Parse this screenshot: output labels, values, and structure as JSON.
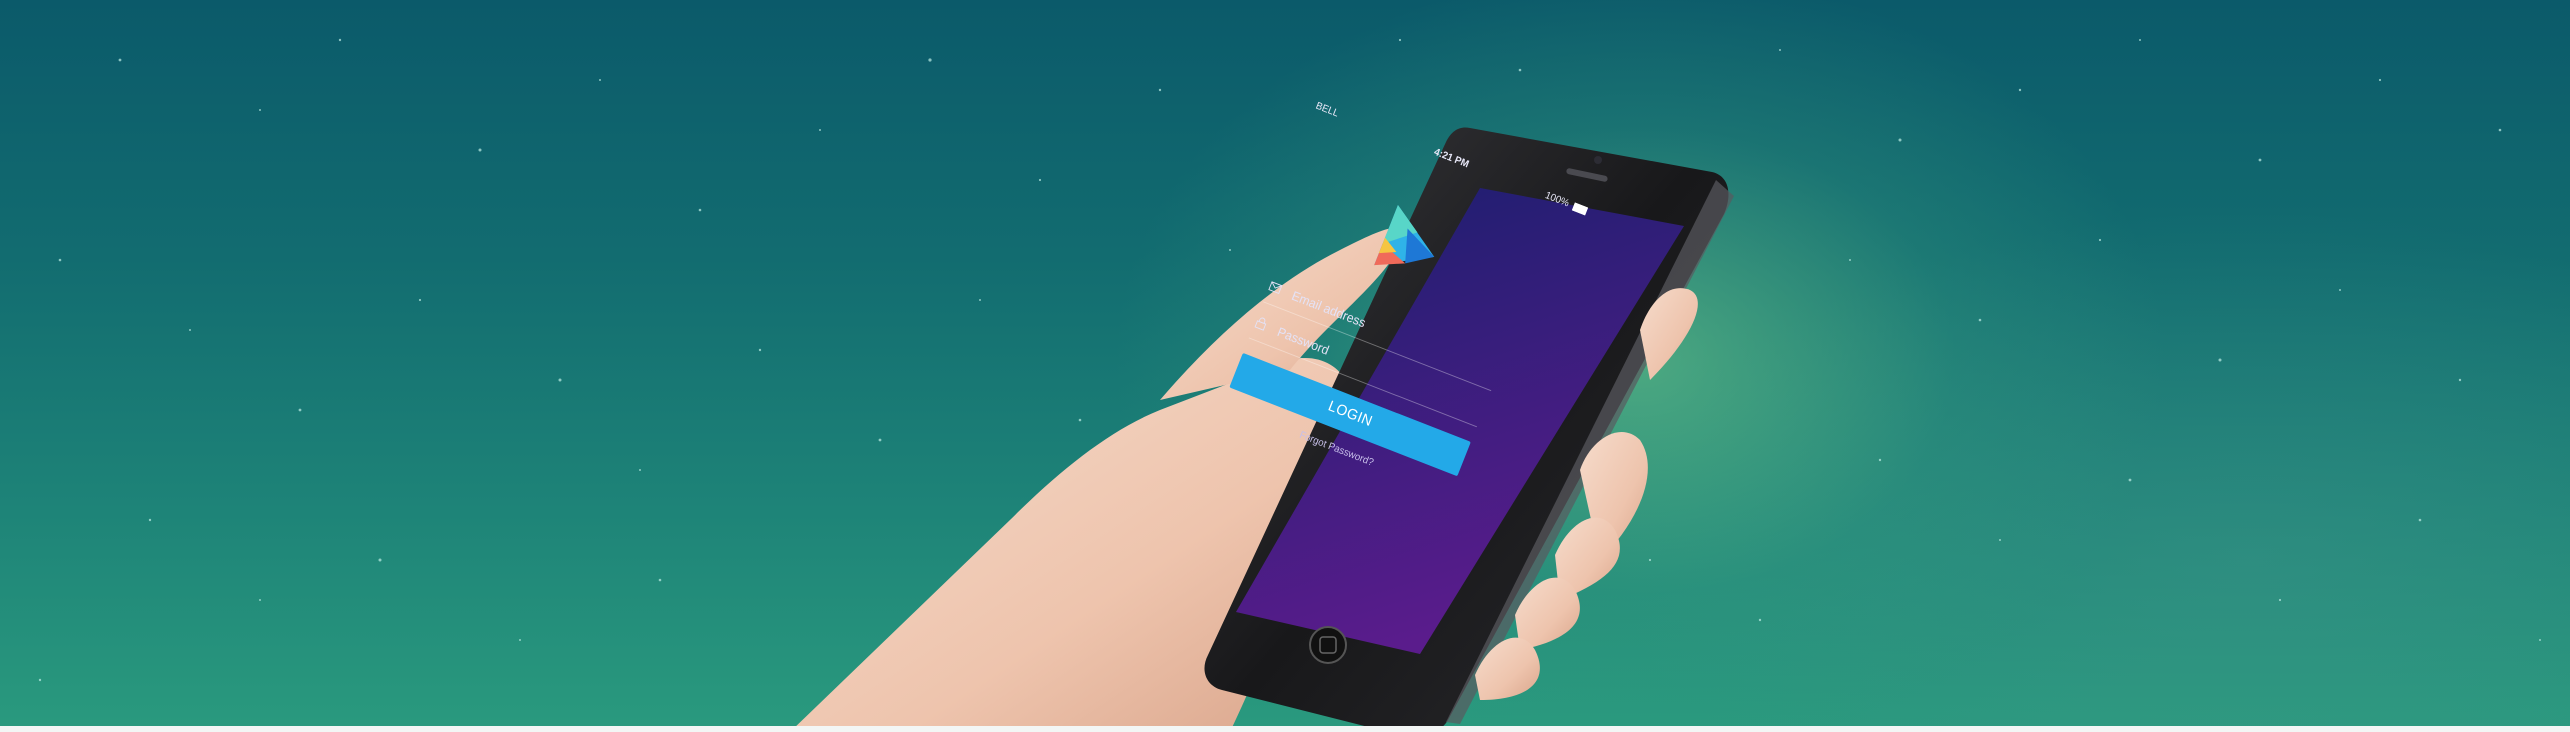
{
  "phone_screen": {
    "status_bar": {
      "carrier": "BELL",
      "time": "4:21 PM",
      "battery": "100%"
    },
    "logo_icon": "triangle-logo-icon",
    "email_field": {
      "icon": "envelope-icon",
      "placeholder": "Email address"
    },
    "password_field": {
      "icon": "lock-icon",
      "placeholder": "Password"
    },
    "login_label": "LOGIN",
    "forgot_password_label": "Forgot Password?"
  },
  "colors": {
    "background_top": "#0b5a6a",
    "background_bottom": "#2a9a7e",
    "screen_gradient_top": "#1a1f6e",
    "screen_gradient_bottom": "#5a1c8c",
    "login_button": "#23a9e8",
    "phone_body": "#1b1b1d"
  }
}
